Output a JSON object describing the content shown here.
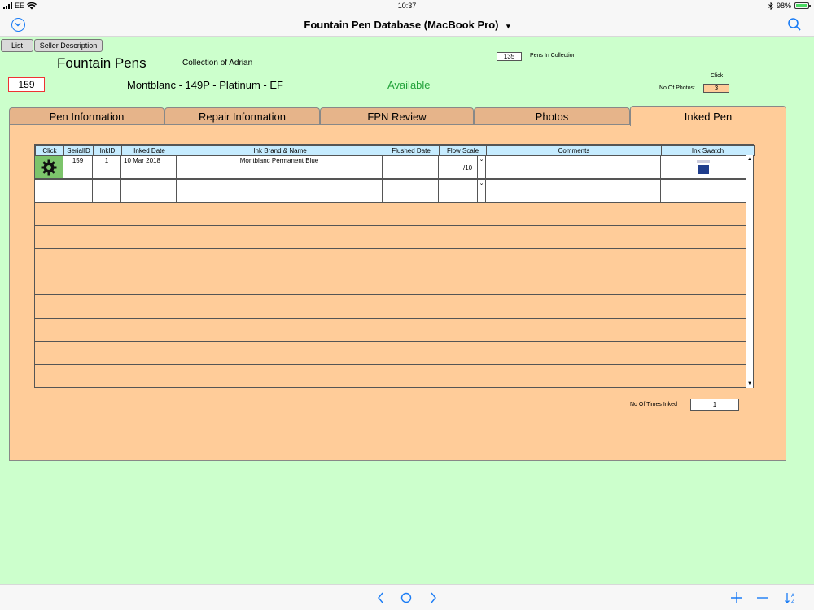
{
  "status": {
    "carrier": "EE",
    "time": "10:37",
    "battery": "98%",
    "battery_level": 0.98
  },
  "titlebar": {
    "title": "Fountain Pen Database (MacBook Pro)",
    "dropdown_glyph": "▾"
  },
  "header": {
    "list_button": "List",
    "seller_button": "Seller Description",
    "heading": "Fountain Pens",
    "collection": "Collection of Adrian",
    "pens_count": "135",
    "pens_label": "Pens In Collection",
    "serial": "159",
    "pen_name": "Montblanc - 149P - Platinum - EF",
    "availability": "Available",
    "click_label": "Click",
    "photos_label": "No Of Photos:",
    "photos_count": "3"
  },
  "tabs": [
    {
      "label": "Pen Information"
    },
    {
      "label": "Repair Information"
    },
    {
      "label": "FPN Review"
    },
    {
      "label": "Photos"
    },
    {
      "label": "Inked Pen"
    }
  ],
  "table": {
    "headers": [
      "Click",
      "SerialID",
      "InkID",
      "Inked Date",
      "Ink Brand & Name",
      "Flushed Date",
      "Flow Scale",
      "Comments",
      "Ink Swatch"
    ],
    "rows": [
      {
        "serial": "159",
        "ink_id": "1",
        "inked_date": "10 Mar 2018",
        "ink": "Montblanc Permanent Blue",
        "flushed": "",
        "flow": "/10",
        "comments": ""
      }
    ]
  },
  "footer": {
    "times_inked_label": "No Of Times Inked",
    "times_inked": "1"
  },
  "colors": {
    "background": "#ccffcc",
    "tab_panel": "#ffcc99",
    "header_cell": "#c6ecff",
    "gear": "#7cc46b",
    "accent": "#1a7cf5"
  },
  "icons": [
    "menu-icon",
    "search-icon",
    "gear-icon",
    "chevron-left-icon",
    "circle-icon",
    "chevron-right-icon",
    "plus-icon",
    "minus-icon",
    "sort-icon"
  ]
}
